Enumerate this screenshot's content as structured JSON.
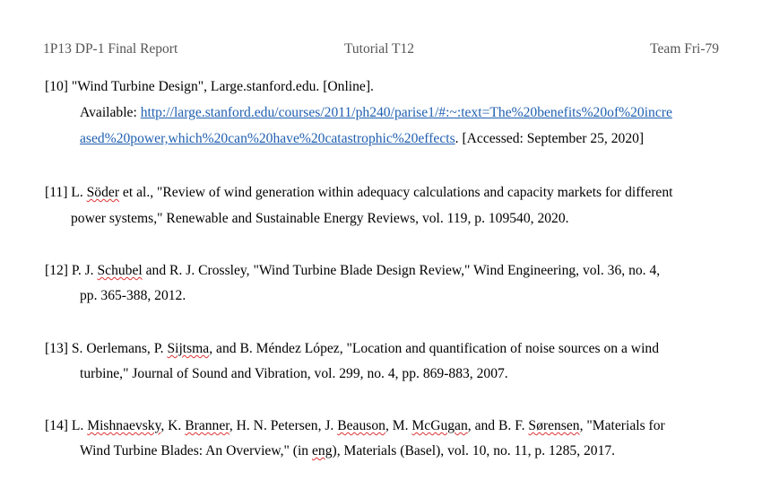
{
  "header": {
    "left": "1P13 DP-1 Final Report",
    "center": "Tutorial T12",
    "right": "Team Fri-79"
  },
  "references": [
    {
      "l1": "[10]  \"Wind Turbine Design\", Large.stanford.edu. [Online].",
      "l2_pre": "Available: ",
      "l2_link": "http://large.stanford.edu/courses/2011/ph240/parise1/#:~:text=The%20benefits%20of%20incre",
      "l3_link": "ased%20power,which%20can%20have%20catastrophic%20effects",
      "l3_post": ". [Accessed: September 25, 2020]"
    },
    {
      "l1a": "[11] L. ",
      "l1b": "Söder",
      "l1c": " et al., \"Review of wind generation within adequacy calculations and capacity markets for different",
      "l2": "power systems,\" Renewable and Sustainable Energy Reviews, vol. 119, p. 109540, 2020."
    },
    {
      "l1a": "[12]  P. J. ",
      "l1b": "Schubel",
      "l1c": " and R. J. Crossley, \"Wind Turbine Blade Design Review,\" Wind Engineering, vol. 36, no. 4,",
      "l2": "pp. 365-388, 2012."
    },
    {
      "l1a": "[13]  S. Oerlemans, P. ",
      "l1b": "Sijtsma",
      "l1c": ", and B. Méndez López, \"Location and quantification of noise sources on a wind",
      "l2a": "turbine,\" Journal of Sound and Vibration, vol. 299, no. 4, pp. 869-883, 2007."
    },
    {
      "l1a": "[14]  L. ",
      "l1b": "Mishnaevsky",
      "l1c": ", K. ",
      "l1d": "Branner",
      "l1e": ", H. N. Petersen, J. ",
      "l1f": "Beauson",
      "l1g": ", M. ",
      "l1h": "McGugan",
      "l1i": ", and B. F. ",
      "l1j": "Sørensen",
      "l1k": ", \"Materials for",
      "l2a": "Wind Turbine Blades: An Overview,\" (in ",
      "l2b": "eng",
      "l2c": "), Materials (Basel), vol. 10, no. 11, p. 1285, 2017."
    }
  ]
}
